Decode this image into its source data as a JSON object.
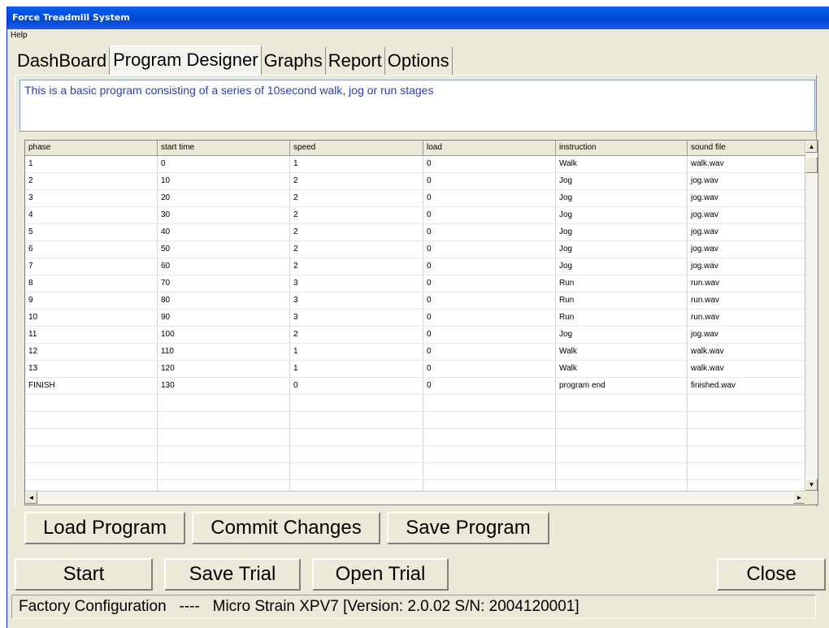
{
  "window": {
    "title": "Force Treadmill System"
  },
  "menu": {
    "items": [
      "Help"
    ]
  },
  "tabs": [
    "DashBoard",
    "Program Designer",
    "Graphs",
    "Report",
    "Options"
  ],
  "active_tab": "Program Designer",
  "description": "This is a basic program consisting of a series of 10second walk, jog or run stages",
  "table": {
    "columns": [
      "phase",
      "start time",
      "speed",
      "load",
      "instruction",
      "sound file"
    ],
    "rows": [
      [
        "1",
        "0",
        "1",
        "0",
        "Walk",
        "walk.wav"
      ],
      [
        "2",
        "10",
        "2",
        "0",
        "Jog",
        "jog.wav"
      ],
      [
        "3",
        "20",
        "2",
        "0",
        "Jog",
        "jog.wav"
      ],
      [
        "4",
        "30",
        "2",
        "0",
        "Jog",
        "jog.wav"
      ],
      [
        "5",
        "40",
        "2",
        "0",
        "Jog",
        "jog.wav"
      ],
      [
        "6",
        "50",
        "2",
        "0",
        "Jog",
        "jog.wav"
      ],
      [
        "7",
        "60",
        "2",
        "0",
        "Jog",
        "jog.wav"
      ],
      [
        "8",
        "70",
        "3",
        "0",
        "Run",
        "run.wav"
      ],
      [
        "9",
        "80",
        "3",
        "0",
        "Run",
        "run.wav"
      ],
      [
        "10",
        "90",
        "3",
        "0",
        "Run",
        "run.wav"
      ],
      [
        "11",
        "100",
        "2",
        "0",
        "Jog",
        "jog.wav"
      ],
      [
        "12",
        "110",
        "1",
        "0",
        "Walk",
        "walk.wav"
      ],
      [
        "13",
        "120",
        "1",
        "0",
        "Walk",
        "walk.wav"
      ],
      [
        "FINISH",
        "130",
        "0",
        "0",
        "program end",
        "finished.wav"
      ]
    ],
    "empty_rows": 7
  },
  "program_buttons": {
    "load": "Load Program",
    "commit": "Commit Changes",
    "save": "Save Program"
  },
  "main_buttons": {
    "start": "Start",
    "save_trial": "Save Trial",
    "open_trial": "Open Trial",
    "close": "Close"
  },
  "status": "Factory Configuration   ----   Micro Strain XPV7 [Version: 2.0.02 S/N: 2004120001]",
  "colors": {
    "titlebar": "#0046d5",
    "description_text": "#2a3fb8",
    "window_bg": "#ece9d8"
  }
}
